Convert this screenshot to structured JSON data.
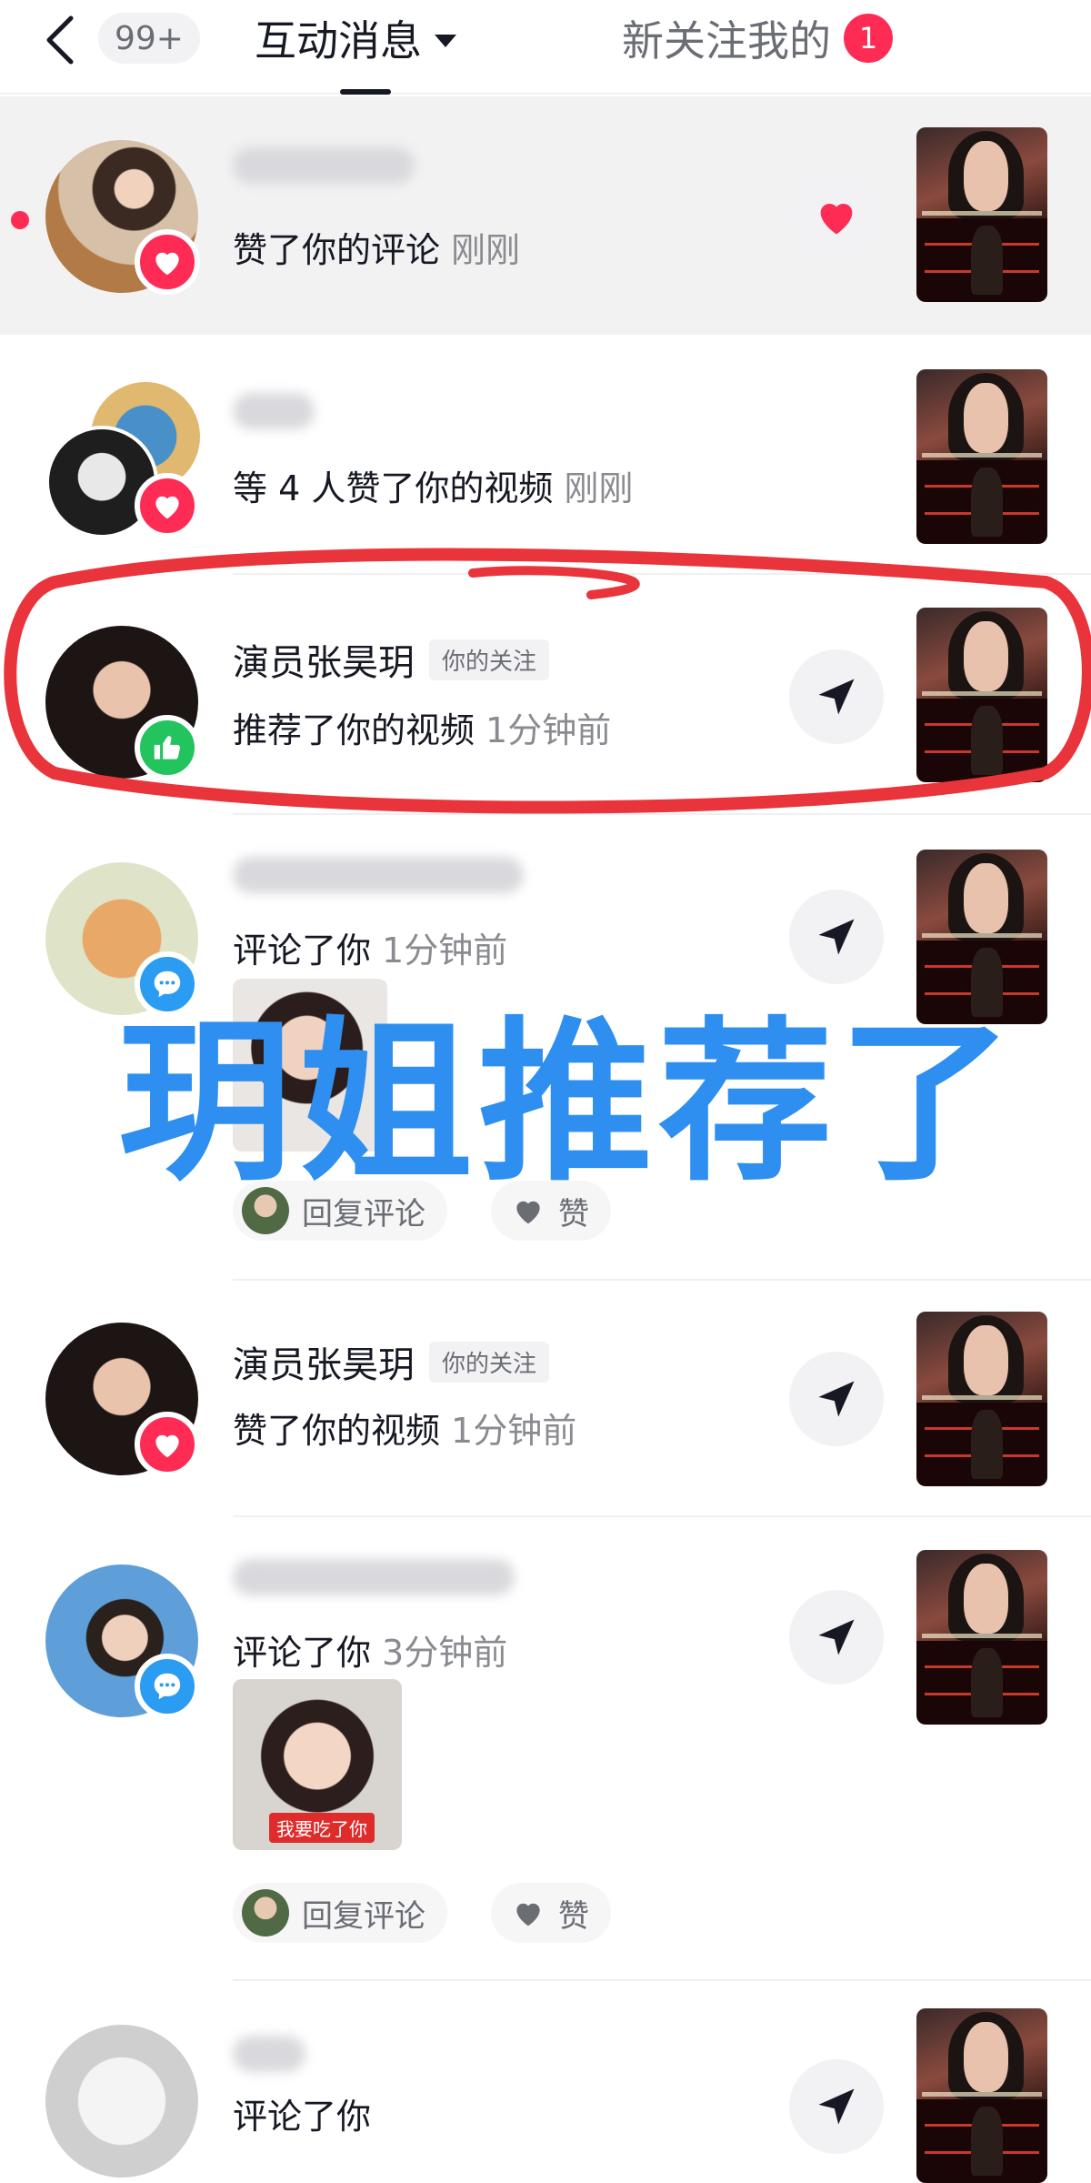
{
  "header": {
    "unread_count": "99+",
    "tab_interactions": "互动消息",
    "tab_new_followers": "新关注我的",
    "new_followers_badge": "1"
  },
  "notifications": [
    {
      "name": "",
      "action": "赞了你的评论",
      "time": "刚刚",
      "badge_icon": "heart-icon",
      "button_icon": "heart-icon",
      "unread": true
    },
    {
      "name": "",
      "action": "等 4 人赞了你的视频",
      "time": "刚刚",
      "badge_icon": "heart-icon"
    },
    {
      "name": "演员张昊玥",
      "tag": "你的关注",
      "action": "推荐了你的视频",
      "time": "1分钟前",
      "badge_icon": "thumbs-up-icon",
      "button_icon": "send-icon"
    },
    {
      "name": "",
      "action": "评论了你",
      "time": "1分钟前",
      "badge_icon": "comment-icon",
      "button_icon": "send-icon",
      "reply_label": "回复评论",
      "like_label": "赞"
    },
    {
      "name": "演员张昊玥",
      "tag": "你的关注",
      "action": "赞了你的视频",
      "time": "1分钟前",
      "badge_icon": "heart-icon",
      "button_icon": "send-icon"
    },
    {
      "name": "",
      "action": "评论了你",
      "time": "3分钟前",
      "badge_icon": "comment-icon",
      "button_icon": "send-icon",
      "comment_sticker_text": "我要吃了你",
      "reply_label": "回复评论",
      "like_label": "赞"
    },
    {
      "name": "",
      "action": "评论了你",
      "time": "",
      "badge_icon": "comment-icon",
      "button_icon": "send-icon"
    }
  ],
  "overlay_text": "玥姐推荐了",
  "colors": {
    "accent_red": "#fe2c55",
    "overlay_blue": "#2f8ff0",
    "annotation_red": "#e8343a",
    "recommend_green": "#23c35e",
    "comment_blue": "#2a9cf2"
  }
}
